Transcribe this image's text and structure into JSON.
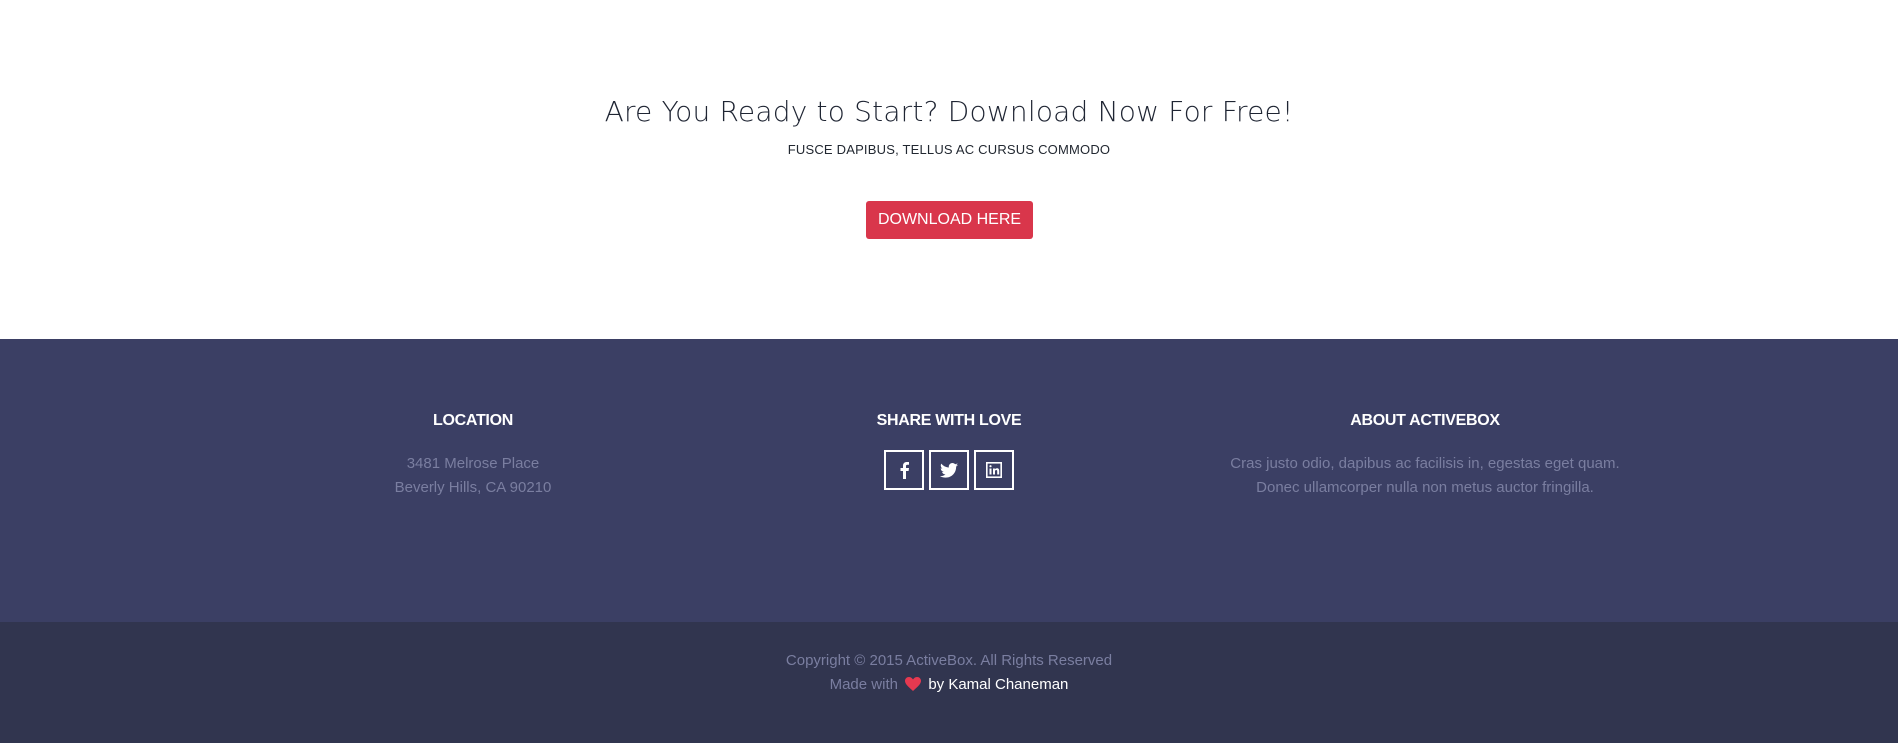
{
  "cta": {
    "title": "Are You Ready to Start? Download Now For Free!",
    "subtitle": "FUSCE DAPIBUS, TELLUS AC CURSUS COMMODO",
    "button_label": "DOWNLOAD HERE",
    "button_color": "#d9364b"
  },
  "footer": {
    "background": "#3b3f64",
    "location": {
      "heading": "LOCATION",
      "line1": "3481 Melrose Place",
      "line2": "Beverly Hills, CA 90210"
    },
    "share": {
      "heading": "SHARE WITH LOVE",
      "icons": [
        "facebook-icon",
        "twitter-icon",
        "linkedin-icon"
      ]
    },
    "about": {
      "heading": "ABOUT ACTIVEBOX",
      "line1": "Cras justo odio, dapibus ac facilisis in, egestas eget quam.",
      "line2": "Donec ullamcorper nulla non metus auctor fringilla."
    }
  },
  "bottom": {
    "copyright": "Copyright © 2015 ActiveBox. All Rights Reserved",
    "made_with": "Made with",
    "author_link": "by Kamal Chaneman",
    "heart_color": "#e63950"
  }
}
